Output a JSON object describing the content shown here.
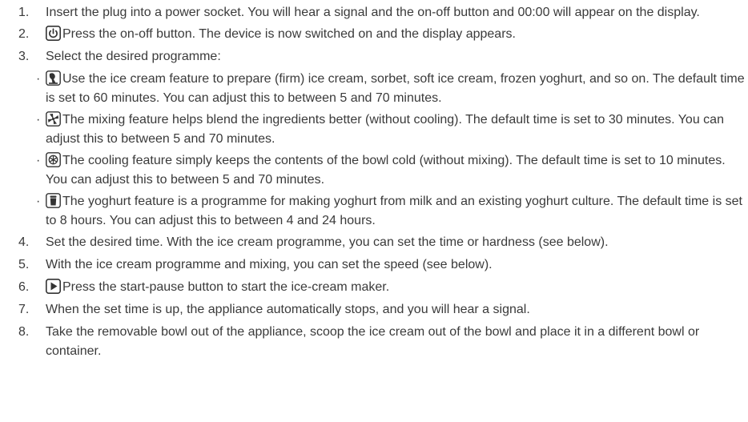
{
  "steps": [
    {
      "num": "1.",
      "text": "Insert the plug into a power socket. You will hear a signal and the on-off button and 00:00 will appear on the display."
    },
    {
      "num": "2.",
      "icon": "power-icon",
      "text": "Press the on-off button. The device is now switched on and the display appears."
    },
    {
      "num": "3.",
      "text": "Select the desired programme:",
      "sub": [
        {
          "bullet": "·",
          "icon": "ice-cream-icon",
          "text": "Use the ice cream feature to prepare (firm) ice cream, sorbet, soft ice cream, frozen yoghurt, and so on. The default time is set to 60 minutes. You can adjust this to between 5 and 70 minutes."
        },
        {
          "bullet": "·",
          "icon": "mixing-fan-icon",
          "text": "The mixing feature helps blend the ingredients better (without cooling).  The default time is set to 30 minutes. You can adjust this to between 5 and 70 minutes."
        },
        {
          "bullet": "·",
          "icon": "cooling-snowflake-icon",
          "text": "The cooling feature simply keeps the contents of the bowl cold (without mixing).  The default time is set to 10 minutes. You can adjust this to between 5 and 70 minutes."
        },
        {
          "bullet": "·",
          "icon": "yoghurt-icon",
          "text": "The yoghurt feature is a programme for making yoghurt from milk and an existing yoghurt culture. The default time is set to 8 hours. You can adjust this to between 4 and 24 hours."
        }
      ]
    },
    {
      "num": "4.",
      "text": "Set the desired time. With the ice cream programme, you can set the time or hardness (see below)."
    },
    {
      "num": "5.",
      "text": "With the ice cream programme and mixing, you can set the speed (see below)."
    },
    {
      "num": "6.",
      "icon": "start-pause-icon",
      "text": "Press the start-pause button to start the ice-cream maker."
    },
    {
      "num": "7.",
      "text": "When the set time is up, the appliance automatically stops, and you will hear a signal."
    },
    {
      "num": "8.",
      "text": "Take the removable bowl out of the appliance, scoop the ice cream out of the bowl and place it in a different bowl or container."
    }
  ]
}
